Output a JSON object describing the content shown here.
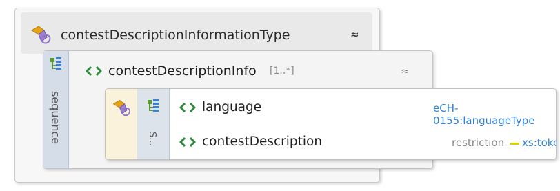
{
  "colors": {
    "element_icon": "#2e8b3a",
    "type_link": "#2f7fd6",
    "restriction_dash": "#d8d000"
  },
  "complex_type": {
    "name": "contestDescriptionInformationType",
    "icon": "complex-type-icon",
    "collapse": "≈"
  },
  "element": {
    "name": "contestDescriptionInfo",
    "cardinality": "[1..*]",
    "icon": "element-icon",
    "compositor_label": "sequence",
    "collapse": "≈"
  },
  "inner": {
    "compositor_label": "S...",
    "children": [
      {
        "name": "language",
        "type": "eCH-0155:languageType"
      },
      {
        "name": "contestDescription",
        "restriction_label": "restriction",
        "base_type": "xs:token"
      }
    ]
  }
}
